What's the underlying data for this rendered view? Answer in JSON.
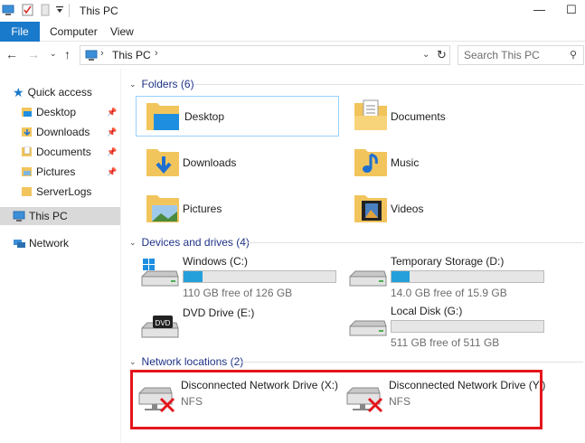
{
  "window": {
    "title": "This PC",
    "minimize": "—",
    "maximize": "☐"
  },
  "ribbon": {
    "tabs": [
      "File",
      "Computer",
      "View"
    ]
  },
  "address": {
    "path": "This PC",
    "search_placeholder": "Search This PC"
  },
  "sidebar": {
    "quick_access": "Quick access",
    "items": [
      {
        "label": "Desktop",
        "pinned": true
      },
      {
        "label": "Downloads",
        "pinned": true
      },
      {
        "label": "Documents",
        "pinned": true
      },
      {
        "label": "Pictures",
        "pinned": true
      },
      {
        "label": "ServerLogs",
        "pinned": false
      }
    ],
    "this_pc": "This PC",
    "network": "Network"
  },
  "groups": {
    "folders": "Folders (6)",
    "devices": "Devices and drives (4)",
    "network": "Network locations (2)"
  },
  "folders": [
    "Desktop",
    "Documents",
    "Downloads",
    "Music",
    "Pictures",
    "Videos"
  ],
  "drives": [
    {
      "label": "Windows (C:)",
      "free": "110 GB free of 126 GB",
      "used_fraction": 0.127
    },
    {
      "label": "Temporary Storage (D:)",
      "free": "14.0 GB free of 15.9 GB",
      "used_fraction": 0.12
    },
    {
      "label": "DVD Drive (E:)",
      "free": "",
      "used_fraction": null
    },
    {
      "label": "Local Disk (G:)",
      "free": "511 GB free of 511 GB",
      "used_fraction": 0.0
    }
  ],
  "network_locations": [
    {
      "label": "Disconnected Network Drive (X:)",
      "type": "NFS"
    },
    {
      "label": "Disconnected Network Drive (Y:)",
      "type": "NFS"
    }
  ],
  "colors": {
    "accent": "#1979ca",
    "group_header": "#1e3287",
    "drive_fill": "#26a0da",
    "highlight_box": "#e3161c"
  }
}
